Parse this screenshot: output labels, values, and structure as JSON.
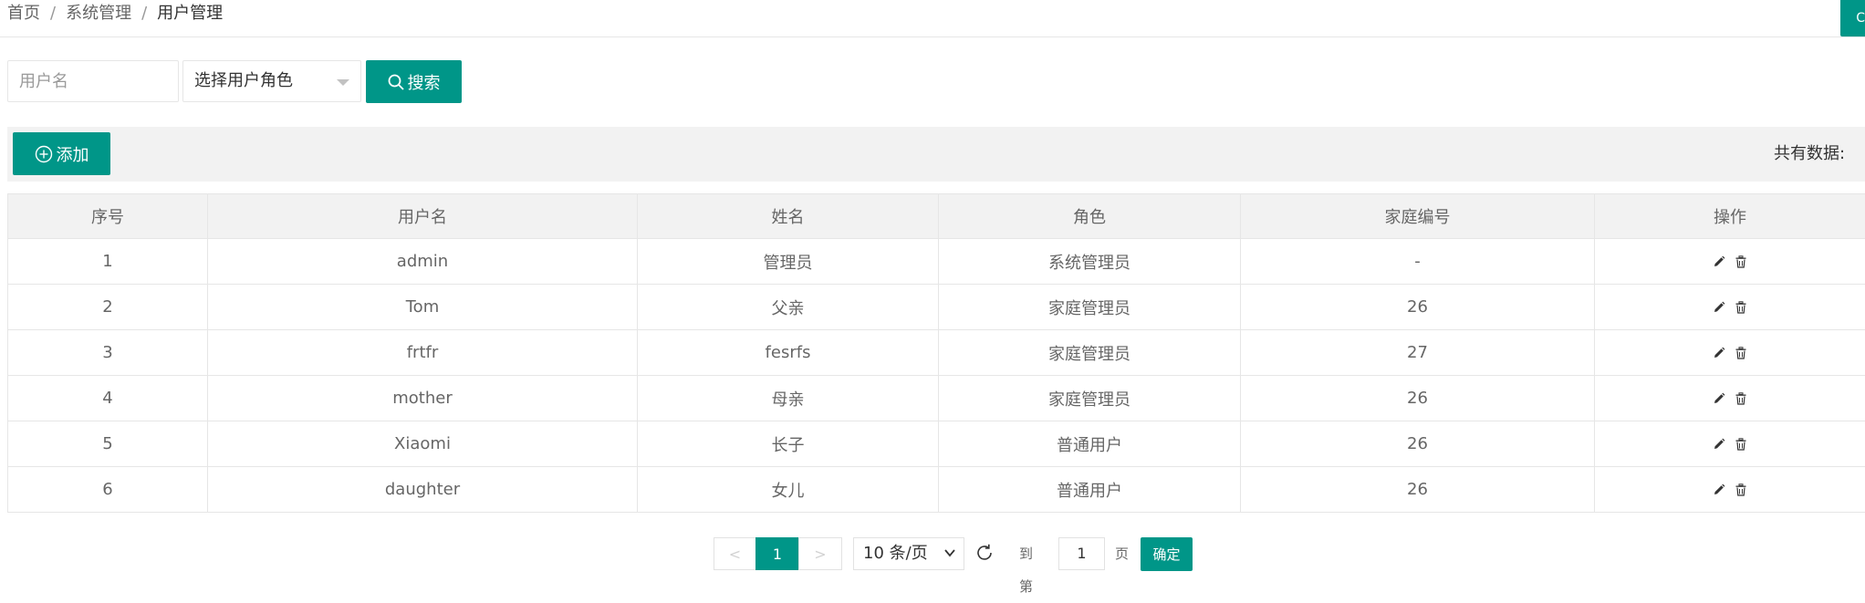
{
  "breadcrumb": {
    "items": [
      "首页",
      "系统管理"
    ],
    "current": "用户管理"
  },
  "corner_button": {
    "label": "C"
  },
  "search": {
    "username_placeholder": "用户名",
    "role_select_value": "选择用户角色",
    "search_label": "搜索"
  },
  "toolbar": {
    "add_label": "添加",
    "total_label": "共有数据:"
  },
  "table": {
    "columns": [
      "序号",
      "用户名",
      "姓名",
      "角色",
      "家庭编号",
      "操作"
    ],
    "rows": [
      {
        "no": "1",
        "username": "admin",
        "name": "管理员",
        "role": "系统管理员",
        "family_id": "-"
      },
      {
        "no": "2",
        "username": "Tom",
        "name": "父亲",
        "role": "家庭管理员",
        "family_id": "26"
      },
      {
        "no": "3",
        "username": "frtfr",
        "name": "fesrfs",
        "role": "家庭管理员",
        "family_id": "27"
      },
      {
        "no": "4",
        "username": "mother",
        "name": "母亲",
        "role": "家庭管理员",
        "family_id": "26"
      },
      {
        "no": "5",
        "username": "Xiaomi",
        "name": "长子",
        "role": "普通用户",
        "family_id": "26"
      },
      {
        "no": "6",
        "username": "daughter",
        "name": "女儿",
        "role": "普通用户",
        "family_id": "26"
      }
    ]
  },
  "pagination": {
    "prev": "<",
    "current": "1",
    "next": ">",
    "limit": "10 条/页",
    "goto_label": "到第",
    "goto_value": "1",
    "page_label": "页",
    "confirm_label": "确定"
  },
  "colors": {
    "accent": "#009688",
    "border": "#e6e6e6",
    "header_bg": "#f2f2f2"
  },
  "icons": {
    "search": "search-icon",
    "add": "add-circle-icon",
    "edit": "edit-icon",
    "delete": "delete-icon",
    "refresh": "refresh-icon"
  }
}
